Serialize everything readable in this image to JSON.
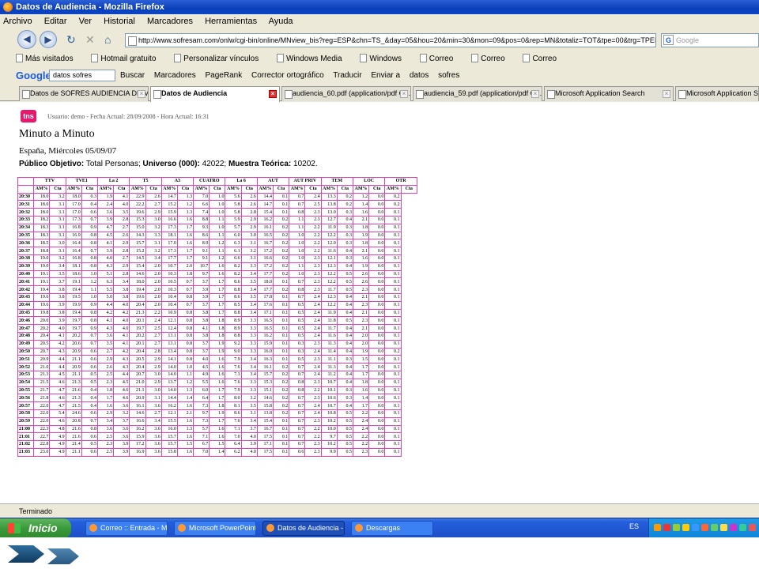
{
  "window": {
    "title": "Datos de Audiencia - Mozilla Firefox"
  },
  "menu": [
    "Archivo",
    "Editar",
    "Ver",
    "Historial",
    "Marcadores",
    "Herramientas",
    "Ayuda"
  ],
  "nav": {
    "url": "http://www.sofresam.com/onlw/cgi-bin/online/MNview_bis?reg=ESP&chn=TS_&day=05&hou=20&min=30&mon=09&pos=0&rep=MN&totaliz=TOT&tpe=00&trg=TPER&yea=07&prin",
    "search_placeholder": "Google"
  },
  "bookmarks": [
    "Más visitados",
    "Hotmail gratuito",
    "Personalizar vínculos",
    "Windows Media",
    "Windows",
    "Correo",
    "Correo",
    "Correo"
  ],
  "google_toolbar": {
    "logo": "Google",
    "query": "datos sofres",
    "items": [
      "Buscar",
      "Marcadores",
      "PageRank",
      "Corrector ortográfico",
      "Traducir",
      "Enviar a",
      "datos",
      "sofres"
    ]
  },
  "tabs": [
    {
      "label": "Datos de SOFRES AUDIENCIA DE M..."
    },
    {
      "label": "Datos de Audiencia"
    },
    {
      "label": "audiencia_60.pdf (application/pdf O..."
    },
    {
      "label": "audiencia_59.pdf (application/pdf O..."
    },
    {
      "label": "Microsoft Application Search"
    },
    {
      "label": "Microsoft Application Search"
    }
  ],
  "page": {
    "logo": "tns",
    "user_line": "Usuario: demo - Fecha Actual: 28/09/2008 - Hora Actual: 16:31",
    "title": "Minuto a Minuto",
    "subtitle": "España, Miércoles 05/09/07",
    "target_label": "Público Objetivo:",
    "target_value": " Total Personas; ",
    "universe_label": "Universo (000):",
    "universe_value": " 42022; ",
    "sample_label": "Muestra Teórica:",
    "sample_value": " 10202."
  },
  "table": {
    "channels": [
      "TTV",
      "TVE1",
      "La 2",
      "T5",
      "A3",
      "CUATRO",
      "La 6",
      "AUT",
      "AUT PRIV",
      "TEM",
      "LOC",
      "OTR"
    ],
    "subheaders": [
      "AM%",
      "Cta"
    ],
    "rows": [
      [
        "20:30",
        "18.0",
        "3.2",
        "18.0",
        "0.3",
        "1.9",
        "4.1",
        "22.9",
        "2.6",
        "14.7",
        "1.3",
        "7.0",
        "1.0",
        "5.6",
        "2.6",
        "14.4",
        "0.1",
        "0.7",
        "2.4",
        "13.3",
        "0.2",
        "1.2",
        "0.0",
        "0.2"
      ],
      [
        "20:31",
        "18.0",
        "3.1",
        "17.0",
        "0.4",
        "2.4",
        "4.0",
        "22.2",
        "2.7",
        "15.2",
        "1.2",
        "6.6",
        "1.0",
        "5.8",
        "2.6",
        "14.7",
        "0.1",
        "0.7",
        "2.5",
        "13.8",
        "0.2",
        "1.4",
        "0.0",
        "0.2"
      ],
      [
        "20:32",
        "18.0",
        "3.1",
        "17.0",
        "0.6",
        "3.6",
        "3.5",
        "19.6",
        "2.9",
        "15.9",
        "1.3",
        "7.4",
        "1.0",
        "5.8",
        "2.8",
        "15.4",
        "0.1",
        "0.8",
        "2.3",
        "13.0",
        "0.3",
        "1.6",
        "0.0",
        "0.1"
      ],
      [
        "20:33",
        "18.2",
        "3.1",
        "17.3",
        "0.7",
        "3.9",
        "2.8",
        "15.3",
        "3.0",
        "16.6",
        "1.6",
        "8.8",
        "1.1",
        "5.9",
        "2.9",
        "16.2",
        "0.2",
        "1.1",
        "2.3",
        "12.7",
        "0.4",
        "2.1",
        "0.0",
        "0.1"
      ],
      [
        "20:34",
        "18.3",
        "3.1",
        "16.8",
        "0.9",
        "4.7",
        "2.7",
        "15.0",
        "3.2",
        "17.3",
        "1.7",
        "9.3",
        "1.0",
        "5.7",
        "2.9",
        "16.1",
        "0.2",
        "1.1",
        "2.2",
        "11.9",
        "0.3",
        "1.8",
        "0.0",
        "0.1"
      ],
      [
        "20:35",
        "18.3",
        "3.1",
        "16.9",
        "0.8",
        "4.5",
        "2.6",
        "14.3",
        "3.3",
        "18.1",
        "1.6",
        "8.6",
        "1.1",
        "6.0",
        "3.0",
        "16.5",
        "0.2",
        "1.0",
        "2.2",
        "12.2",
        "0.3",
        "1.9",
        "0.0",
        "0.1"
      ],
      [
        "20:36",
        "18.5",
        "3.0",
        "16.4",
        "0.8",
        "4.1",
        "2.9",
        "15.7",
        "3.1",
        "17.0",
        "1.6",
        "8.9",
        "1.2",
        "6.3",
        "3.1",
        "16.7",
        "0.2",
        "1.0",
        "2.2",
        "12.0",
        "0.3",
        "1.8",
        "0.0",
        "0.1"
      ],
      [
        "20:37",
        "18.8",
        "3.1",
        "16.4",
        "0.7",
        "3.9",
        "2.8",
        "15.2",
        "3.2",
        "17.3",
        "1.7",
        "9.1",
        "1.1",
        "6.1",
        "3.2",
        "17.2",
        "0.2",
        "1.0",
        "2.2",
        "11.6",
        "0.4",
        "2.1",
        "0.0",
        "0.1"
      ],
      [
        "20:38",
        "19.0",
        "3.2",
        "16.8",
        "0.8",
        "4.0",
        "2.7",
        "14.5",
        "3.4",
        "17.7",
        "1.7",
        "9.1",
        "1.2",
        "6.6",
        "3.1",
        "16.6",
        "0.2",
        "1.0",
        "2.3",
        "12.1",
        "0.3",
        "1.6",
        "0.0",
        "0.1"
      ],
      [
        "20:39",
        "19.0",
        "3.4",
        "18.1",
        "0.8",
        "4.3",
        "2.9",
        "15.4",
        "2.0",
        "10.7",
        "2.0",
        "10.7",
        "1.6",
        "8.2",
        "3.3",
        "17.2",
        "0.2",
        "1.1",
        "2.3",
        "12.3",
        "0.4",
        "1.9",
        "0.0",
        "0.1"
      ],
      [
        "20:40",
        "19.1",
        "3.5",
        "18.6",
        "1.0",
        "5.1",
        "2.8",
        "14.6",
        "2.0",
        "10.3",
        "1.8",
        "9.7",
        "1.6",
        "8.2",
        "3.4",
        "17.7",
        "0.2",
        "1.0",
        "2.3",
        "12.2",
        "0.5",
        "2.6",
        "0.0",
        "0.1"
      ],
      [
        "20:41",
        "19.1",
        "3.7",
        "19.1",
        "1.2",
        "6.3",
        "3.4",
        "18.0",
        "2.0",
        "10.5",
        "0.7",
        "3.7",
        "1.7",
        "8.6",
        "3.5",
        "18.0",
        "0.1",
        "0.7",
        "2.3",
        "12.2",
        "0.5",
        "2.6",
        "0.0",
        "0.1"
      ],
      [
        "20:42",
        "19.4",
        "3.8",
        "19.4",
        "1.1",
        "5.5",
        "3.8",
        "19.4",
        "2.0",
        "10.3",
        "0.7",
        "3.9",
        "1.7",
        "8.8",
        "3.4",
        "17.7",
        "0.2",
        "0.8",
        "2.3",
        "11.7",
        "0.5",
        "2.3",
        "0.0",
        "0.1"
      ],
      [
        "20:43",
        "19.6",
        "3.8",
        "19.5",
        "1.0",
        "5.0",
        "3.8",
        "19.6",
        "2.0",
        "10.4",
        "0.8",
        "3.9",
        "1.7",
        "8.6",
        "3.5",
        "17.8",
        "0.1",
        "0.7",
        "2.4",
        "12.3",
        "0.4",
        "2.1",
        "0.0",
        "0.1"
      ],
      [
        "20:44",
        "19.6",
        "3.9",
        "19.9",
        "0.9",
        "4.4",
        "4.0",
        "20.4",
        "2.0",
        "10.4",
        "0.7",
        "3.7",
        "1.7",
        "8.5",
        "3.4",
        "17.6",
        "0.1",
        "0.5",
        "2.4",
        "12.2",
        "0.4",
        "2.3",
        "0.0",
        "0.1"
      ],
      [
        "20:45",
        "19.8",
        "3.8",
        "19.4",
        "0.8",
        "4.2",
        "4.2",
        "21.3",
        "2.2",
        "10.9",
        "0.8",
        "3.8",
        "1.7",
        "8.8",
        "3.4",
        "17.1",
        "0.1",
        "0.5",
        "2.4",
        "11.9",
        "0.4",
        "2.1",
        "0.0",
        "0.1"
      ],
      [
        "20:46",
        "20.0",
        "3.9",
        "19.7",
        "0.8",
        "4.1",
        "4.0",
        "20.1",
        "2.4",
        "12.1",
        "0.8",
        "3.8",
        "1.8",
        "8.9",
        "3.3",
        "16.5",
        "0.1",
        "0.5",
        "2.4",
        "11.8",
        "0.5",
        "2.3",
        "0.0",
        "0.1"
      ],
      [
        "20:47",
        "20.2",
        "4.0",
        "19.7",
        "0.9",
        "4.3",
        "4.0",
        "19.7",
        "2.5",
        "12.4",
        "0.8",
        "4.1",
        "1.8",
        "8.9",
        "3.3",
        "16.5",
        "0.1",
        "0.5",
        "2.4",
        "11.7",
        "0.4",
        "2.1",
        "0.0",
        "0.1"
      ],
      [
        "20:48",
        "20.4",
        "4.1",
        "20.2",
        "0.7",
        "3.6",
        "4.1",
        "20.2",
        "2.7",
        "13.1",
        "0.8",
        "3.8",
        "1.8",
        "8.8",
        "3.3",
        "16.2",
        "0.1",
        "0.5",
        "2.4",
        "11.6",
        "0.4",
        "2.0",
        "0.0",
        "0.1"
      ],
      [
        "20:49",
        "20.5",
        "4.2",
        "20.6",
        "0.7",
        "3.5",
        "4.1",
        "20.1",
        "2.7",
        "13.1",
        "0.8",
        "3.7",
        "1.9",
        "9.2",
        "3.3",
        "15.9",
        "0.1",
        "0.3",
        "2.3",
        "11.3",
        "0.4",
        "2.0",
        "0.0",
        "0.1"
      ],
      [
        "20:50",
        "20.7",
        "4.3",
        "20.9",
        "0.6",
        "2.7",
        "4.2",
        "20.4",
        "2.8",
        "13.4",
        "0.8",
        "3.7",
        "1.9",
        "9.0",
        "3.3",
        "16.0",
        "0.1",
        "0.3",
        "2.4",
        "11.4",
        "0.4",
        "1.9",
        "0.0",
        "0.2"
      ],
      [
        "20:51",
        "20.9",
        "4.4",
        "21.1",
        "0.6",
        "2.9",
        "4.3",
        "20.5",
        "2.9",
        "14.1",
        "0.8",
        "4.0",
        "1.6",
        "7.9",
        "3.4",
        "16.3",
        "0.1",
        "0.5",
        "2.3",
        "11.1",
        "0.3",
        "1.5",
        "0.0",
        "0.1"
      ],
      [
        "20:52",
        "21.0",
        "4.4",
        "20.9",
        "0.6",
        "2.6",
        "4.3",
        "20.4",
        "2.9",
        "14.0",
        "1.0",
        "4.5",
        "1.6",
        "7.6",
        "3.4",
        "16.1",
        "0.2",
        "0.7",
        "2.4",
        "11.3",
        "0.4",
        "1.7",
        "0.0",
        "0.1"
      ],
      [
        "20:53",
        "21.3",
        "4.5",
        "21.1",
        "0.5",
        "2.5",
        "4.4",
        "20.7",
        "3.0",
        "14.0",
        "1.1",
        "4.9",
        "1.6",
        "7.3",
        "3.4",
        "15.7",
        "0.2",
        "0.7",
        "2.4",
        "11.2",
        "0.4",
        "1.7",
        "0.0",
        "0.1"
      ],
      [
        "20:54",
        "21.5",
        "4.6",
        "21.3",
        "0.5",
        "2.3",
        "4.5",
        "21.0",
        "2.9",
        "13.7",
        "1.2",
        "5.5",
        "1.6",
        "7.6",
        "3.3",
        "15.3",
        "0.2",
        "0.8",
        "2.3",
        "10.7",
        "0.4",
        "1.8",
        "0.0",
        "0.1"
      ],
      [
        "20:55",
        "21.7",
        "4.7",
        "21.6",
        "0.4",
        "1.8",
        "4.6",
        "21.1",
        "3.0",
        "14.0",
        "1.3",
        "6.0",
        "1.7",
        "7.9",
        "3.3",
        "15.1",
        "0.2",
        "0.8",
        "2.2",
        "10.1",
        "0.3",
        "1.6",
        "0.0",
        "0.1"
      ],
      [
        "20:56",
        "21.8",
        "4.6",
        "21.3",
        "0.4",
        "1.7",
        "4.6",
        "20.9",
        "3.1",
        "14.4",
        "1.4",
        "6.4",
        "1.7",
        "8.0",
        "3.2",
        "14.6",
        "0.2",
        "0.7",
        "2.3",
        "10.6",
        "0.3",
        "1.4",
        "0.0",
        "0.1"
      ],
      [
        "20:57",
        "22.0",
        "4.7",
        "21.5",
        "0.4",
        "1.6",
        "3.6",
        "16.1",
        "3.6",
        "16.2",
        "1.6",
        "7.3",
        "1.8",
        "8.1",
        "3.5",
        "15.8",
        "0.2",
        "0.7",
        "2.4",
        "10.7",
        "0.4",
        "1.7",
        "0.0",
        "0.1"
      ],
      [
        "20:58",
        "22.0",
        "5.4",
        "24.6",
        "0.6",
        "2.9",
        "3.2",
        "14.6",
        "2.7",
        "12.1",
        "2.1",
        "9.7",
        "1.9",
        "8.6",
        "3.1",
        "13.8",
        "0.2",
        "0.7",
        "2.4",
        "10.8",
        "0.5",
        "2.2",
        "0.0",
        "0.1"
      ],
      [
        "20:59",
        "22.0",
        "4.6",
        "20.8",
        "0.7",
        "3.4",
        "3.7",
        "16.6",
        "3.4",
        "15.5",
        "1.6",
        "7.3",
        "1.7",
        "7.6",
        "3.4",
        "15.4",
        "0.1",
        "0.7",
        "2.3",
        "10.2",
        "0.5",
        "2.4",
        "0.0",
        "0.1"
      ],
      [
        "21:00",
        "22.3",
        "4.8",
        "21.6",
        "0.8",
        "3.6",
        "3.6",
        "16.2",
        "3.6",
        "16.0",
        "1.3",
        "5.7",
        "1.6",
        "7.1",
        "3.7",
        "16.7",
        "0.1",
        "0.7",
        "2.2",
        "10.0",
        "0.5",
        "2.4",
        "0.0",
        "0.1"
      ],
      [
        "21:01",
        "22.7",
        "4.9",
        "21.6",
        "0.6",
        "2.5",
        "3.6",
        "15.9",
        "3.6",
        "15.7",
        "1.6",
        "7.1",
        "1.6",
        "7.0",
        "4.0",
        "17.5",
        "0.1",
        "0.7",
        "2.2",
        "9.7",
        "0.5",
        "2.2",
        "0.0",
        "0.1"
      ],
      [
        "21:02",
        "22.8",
        "4.9",
        "21.4",
        "0.5",
        "2.3",
        "3.9",
        "17.2",
        "3.6",
        "15.7",
        "1.5",
        "6.7",
        "1.5",
        "6.4",
        "3.9",
        "17.1",
        "0.1",
        "0.7",
        "2.3",
        "10.2",
        "0.5",
        "2.2",
        "0.0",
        "0.1"
      ],
      [
        "21:03",
        "23.0",
        "4.9",
        "21.1",
        "0.6",
        "2.5",
        "3.9",
        "16.9",
        "3.6",
        "15.8",
        "1.6",
        "7.0",
        "1.4",
        "6.2",
        "4.0",
        "17.5",
        "0.1",
        "0.6",
        "2.3",
        "9.9",
        "0.5",
        "2.3",
        "0.0",
        "0.1"
      ]
    ]
  },
  "status": {
    "text": "Terminado"
  },
  "taskbar": {
    "start": "Inicio",
    "tasks": [
      "Correo :: Entrada - M...",
      "Microsoft PowerPoint ...",
      "Datos de Audiencia - ...",
      "Descargas"
    ],
    "lang": "ES"
  }
}
